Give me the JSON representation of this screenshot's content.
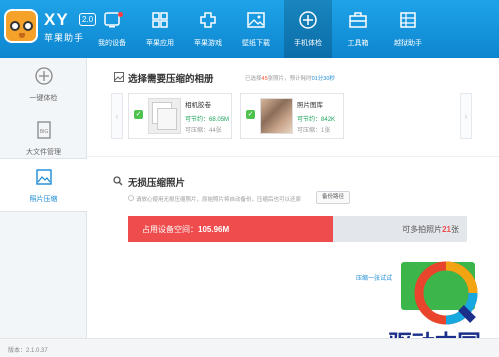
{
  "app": {
    "brand": "XY",
    "version_badge": "2.0",
    "subtitle": "苹果助手"
  },
  "nav": [
    {
      "label": "我的设备",
      "icon": "device-icon"
    },
    {
      "label": "苹果应用",
      "icon": "apps-icon"
    },
    {
      "label": "苹果游戏",
      "icon": "gamepad-icon"
    },
    {
      "label": "壁纸下载",
      "icon": "wallpaper-icon"
    },
    {
      "label": "手机体检",
      "icon": "plus-circle-icon",
      "active": true
    },
    {
      "label": "工具箱",
      "icon": "toolbox-icon"
    },
    {
      "label": "越狱助手",
      "icon": "jailbreak-icon"
    }
  ],
  "sidebar": [
    {
      "label": "一键体检",
      "icon": "plus-circle-icon"
    },
    {
      "label": "大文件管理",
      "icon": "bigfile-icon"
    },
    {
      "label": "照片压缩",
      "icon": "photo-icon",
      "active": true
    }
  ],
  "album_section": {
    "title": "选择需要压缩的相册",
    "info_prefix": "已选择",
    "info_count": "45",
    "info_mid": "张照片，预计耗时",
    "info_time": "01分30秒",
    "albums": [
      {
        "name": "相机胶卷",
        "save_label": "可节约：",
        "save_value": "68.05M",
        "count_label": "可压缩：",
        "count_value": "44张"
      },
      {
        "name": "照片图库",
        "save_label": "可节约：",
        "save_value": "842K",
        "count_label": "可压缩：",
        "count_value": "1张"
      }
    ]
  },
  "compress_section": {
    "title": "无损压缩照片",
    "notice": "请放心使用无损压缩照片，原始照片将自动备份，压缩后也可以还原",
    "backup_button": "备份路径",
    "storage": {
      "used_label": "占用设备空间：",
      "used_value": "105.96M",
      "more_prefix": "可多拍照片",
      "more_count": "21",
      "more_suffix": "张",
      "fill_ratio": 0.605
    },
    "link": "压缩一张试试"
  },
  "watermark": {
    "text": "驱动中国"
  },
  "footer": {
    "version": "版本：2.1.0.37"
  }
}
